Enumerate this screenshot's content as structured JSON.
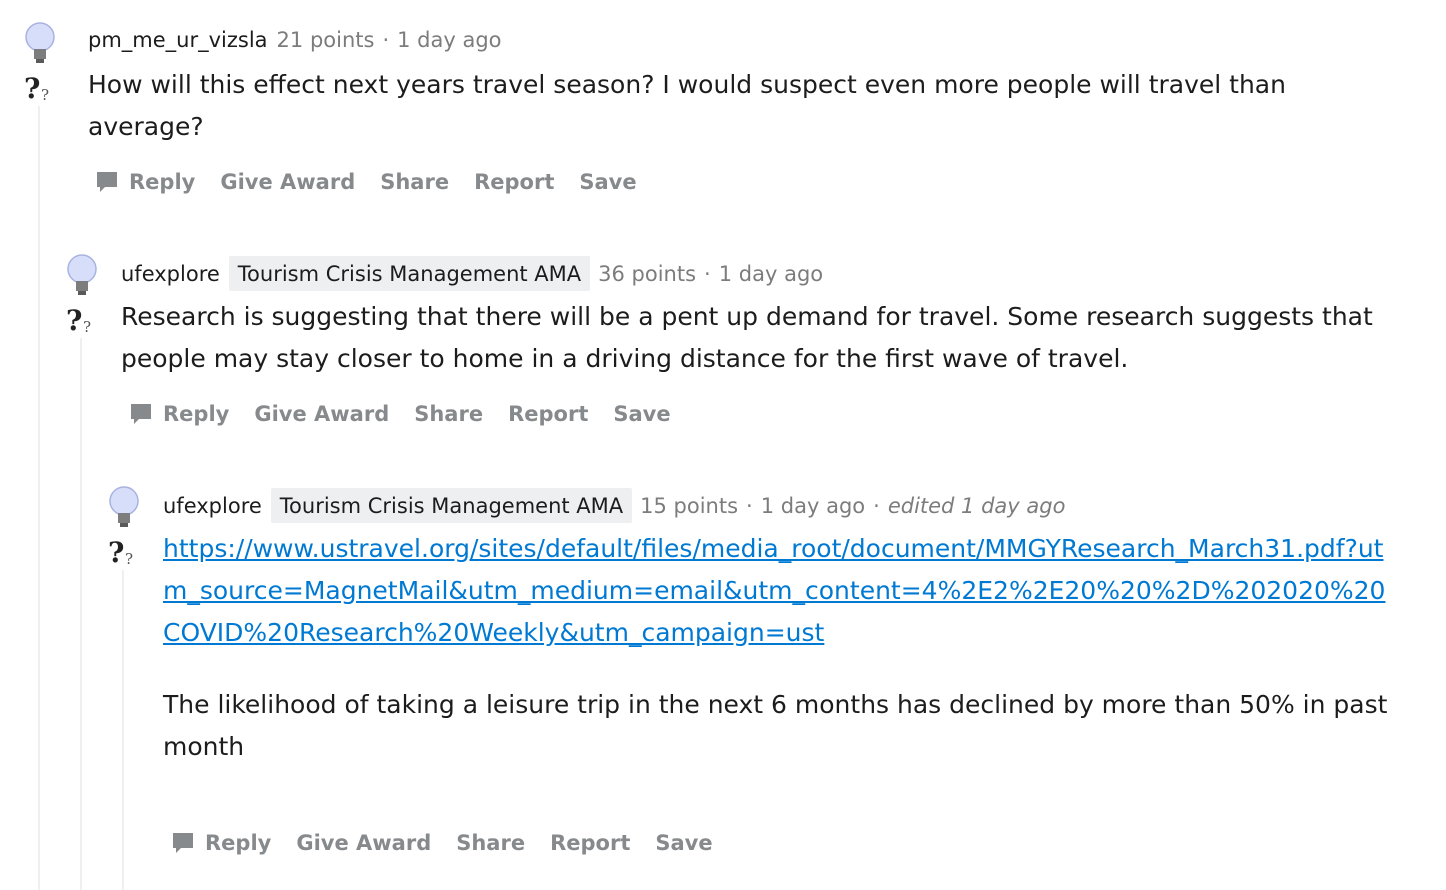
{
  "comments": [
    {
      "author": "pm_me_ur_vizsla",
      "flair": "",
      "points": "21 points",
      "time": "1 day ago",
      "edited": "",
      "text": "How will this effect next years travel season? I would suspect even more people will travel than average?",
      "link": "",
      "text2": ""
    },
    {
      "author": "ufexplore",
      "flair": "Tourism Crisis Management AMA",
      "points": "36 points",
      "time": "1 day ago",
      "edited": "",
      "text": "Research is suggesting that there will be a pent up demand for travel. Some research suggests that people may stay closer to home in a driving distance for the first wave of travel.",
      "link": "",
      "text2": ""
    },
    {
      "author": "ufexplore",
      "flair": "Tourism Crisis Management AMA",
      "points": "15 points",
      "time": "1 day ago",
      "edited": "edited 1 day ago",
      "text": "",
      "link": "https://www.ustravel.org/sites/default/files/media_root/document/MMGYResearch_March31.pdf?utm_source=MagnetMail&utm_medium=email&utm_content=4%2E2%2E20%20%2D%202020%20COVID%20Research%20Weekly&utm_campaign=ust",
      "text2": "The likelihood of taking a leisure trip in the next 6 months has declined by more than 50% in past month"
    }
  ],
  "actions": {
    "reply": "Reply",
    "give_award": "Give Award",
    "share": "Share",
    "report": "Report",
    "save": "Save"
  },
  "separator": "·",
  "icons": {
    "avatar": "lightbulb-question-avatar-icon",
    "reply": "speech-bubble-icon"
  },
  "colors": {
    "link": "#0079d3",
    "meta": "#7c7c7c",
    "action": "#878a8c",
    "flair_bg": "#edeff1"
  }
}
